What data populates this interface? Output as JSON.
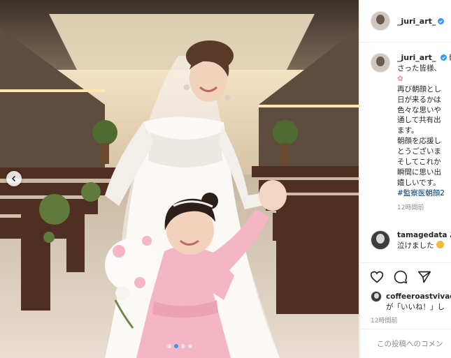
{
  "post": {
    "author": "_juri_art_",
    "photo_alt": "",
    "caption_lines": [
      "朝",
      "さった皆様、",
      "再び朝顔とし",
      "日が来るかは",
      "色々な思いや",
      "通して共有出",
      "ます。",
      "朝顔を応援し",
      "とうございま",
      "そしてこれか",
      "瞬間に思い出",
      "嬉しいです。"
    ],
    "hashtag": "#監察医朝顔2",
    "caption_time": "12時間前",
    "carousel": {
      "total": 4,
      "active_index": 1
    }
  },
  "comment": {
    "username": "tamagedata",
    "text_line1": "あ",
    "text_line2": "泣けました"
  },
  "likes": {
    "username": "coffeeroastvivace",
    "text": "が「いいね！」し"
  },
  "post_time": "12時間前",
  "add_comment_placeholder": "この投稿へのコメン",
  "colors": {
    "accent": "#3897f0",
    "hashtag": "#003569",
    "muted": "#8e8e8e"
  },
  "icons": {
    "like": "heart-icon",
    "comment": "comment-icon",
    "share": "share-icon",
    "verified": "verified-badge-icon",
    "flower": "cherry-blossom-emoji",
    "emoji": "crying-face-emoji"
  }
}
